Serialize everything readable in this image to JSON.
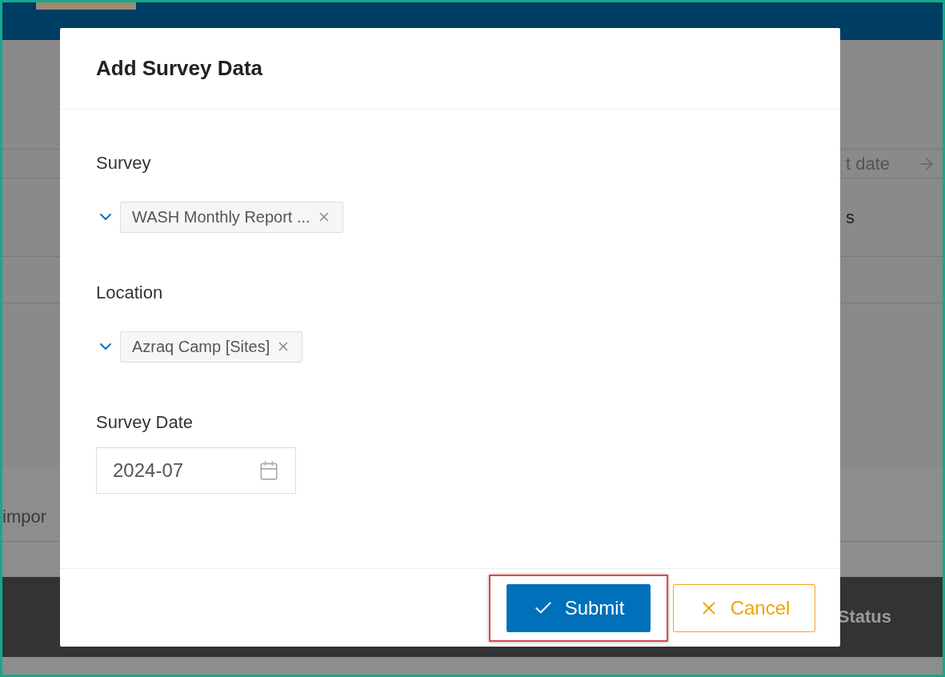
{
  "background": {
    "date_filter": "t date",
    "row_text": "s",
    "import_text": "impor",
    "table_header": "Status"
  },
  "dialog": {
    "title": "Add Survey Data",
    "fields": [
      {
        "kind": "multiselect",
        "label": "Survey",
        "tags": [
          "WASH Monthly Report ..."
        ]
      },
      {
        "kind": "multiselect",
        "label": "Location",
        "tags": [
          "Azraq Camp [Sites]"
        ]
      },
      {
        "kind": "date",
        "label": "Survey Date",
        "value": "2024-07"
      }
    ],
    "buttons": [
      {
        "kind": "primary",
        "label": "Submit",
        "highlighted": true
      },
      {
        "kind": "secondary",
        "label": "Cancel",
        "highlighted": false
      }
    ]
  }
}
